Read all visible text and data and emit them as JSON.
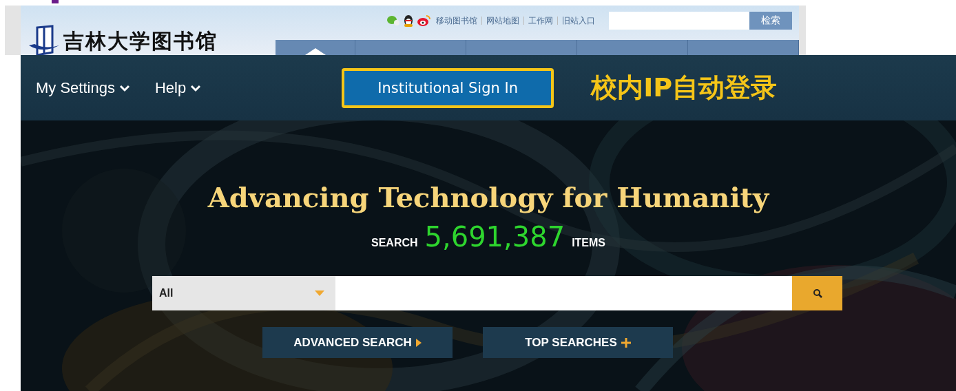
{
  "library": {
    "logo_text": "吉林大学图书馆",
    "links": [
      "移动图书馆",
      "网站地图",
      "工作网",
      "旧站入口"
    ],
    "search_button": "检索"
  },
  "ieee": {
    "menus": [
      "My Settings",
      "Help"
    ],
    "sign_in": "Institutional Sign In",
    "annotation": "校内IP自动登录",
    "headline": "Advancing Technology for Humanity",
    "count_prefix": "SEARCH",
    "count": "5,691,387",
    "count_suffix": "ITEMS",
    "scope": "All",
    "buttons": [
      {
        "label": "ADVANCED SEARCH",
        "kind": "arrow"
      },
      {
        "label": "TOP SEARCHES",
        "kind": "plus"
      }
    ]
  }
}
